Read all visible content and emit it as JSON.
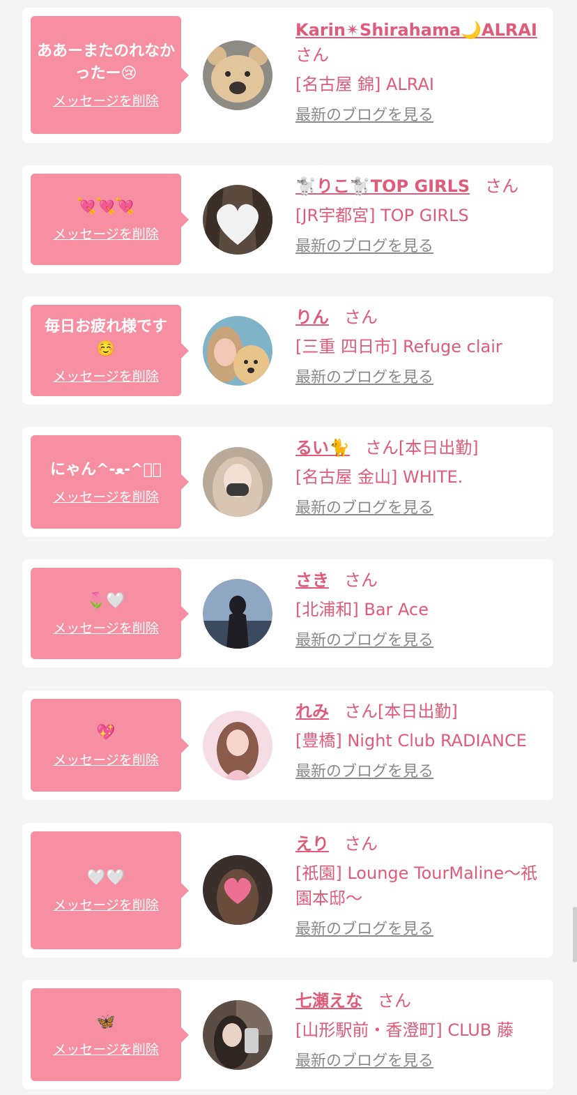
{
  "colors": {
    "bubble": "#f68fa1",
    "accent": "#e05a79",
    "muted_link": "#8a8a8a",
    "background": "#f4f4f5",
    "card": "#ffffff"
  },
  "delete_label": "メッセージを削除",
  "blog_label": "最新のブログを見る",
  "messages": [
    {
      "message": "ああーまたのれなかったー😢",
      "name": "Karin✴︎Shirahama🌙ALRAI",
      "san": "さん",
      "shop": "[名古屋 錦] ALRAI"
    },
    {
      "message": "💘💘💘",
      "name": "🐩りこ🐩TOP GIRLS",
      "san": "さん",
      "shop": "[JR宇都宮] TOP GIRLS"
    },
    {
      "message": "毎日お疲れ様です☺️",
      "name": "りん",
      "san": "さん",
      "shop": "[三重 四日市] Refuge clair"
    },
    {
      "message": "にゃん^-ﻌ-^ฅ゙",
      "name": "るい🐈",
      "san": "さん[本日出勤]",
      "shop": "[名古屋 金山] WHITE."
    },
    {
      "message": "🌷🤍",
      "name": "さき",
      "san": "さん",
      "shop": "[北浦和] Bar Ace"
    },
    {
      "message": "💖",
      "name": "れみ",
      "san": "さん[本日出勤]",
      "shop": "[豊橋] Night Club RADIANCE"
    },
    {
      "message": "🤍🤍",
      "name": "えり",
      "san": "さん",
      "shop": "[祇園] Lounge TourMaline〜祇園本邸〜"
    },
    {
      "message": "🦋",
      "name": "七瀬えな",
      "san": "さん",
      "shop": "[山形駅前・香澄町] CLUB 藤"
    }
  ]
}
